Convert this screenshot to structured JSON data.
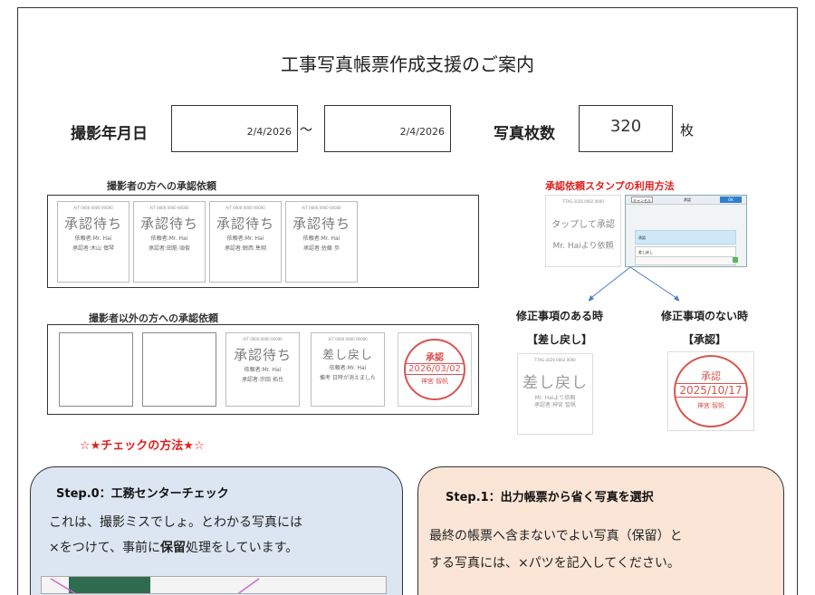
{
  "title": "工事写真帳票作成支援のご案内",
  "header": {
    "date_label": "撮影年月日",
    "date_from": "2/4/2026",
    "tilde": "～",
    "date_to": "2/4/2026",
    "count_label": "写真枚数",
    "count_value": "320",
    "count_unit": "枚"
  },
  "photographer_section": {
    "label": "撮影者の方への承認依頼",
    "stamps": [
      {
        "hdr": "A/T 0000 0000 00000",
        "big": "承認待ち",
        "line1": "依頼者:Mr. Hai",
        "line2": "承認者:木山 慎琴"
      },
      {
        "hdr": "A/T 0000 0000 00000",
        "big": "承認待ち",
        "line1": "依頼者:Mr. Hai",
        "line2": "承認者:田筋 頃俊"
      },
      {
        "hdr": "A/T 0000 0000 00000",
        "big": "承認待ち",
        "line1": "依頼者:Mr. Hai",
        "line2": "承認者:鯨西 隼翔"
      },
      {
        "hdr": "A/T 0000 0000 00000",
        "big": "承認待ち",
        "line1": "依頼者:Mr. Hai",
        "line2": "承認者:佐藤 歩"
      }
    ]
  },
  "others_section": {
    "label": "撮影者以外の方への承認依頼",
    "stamp_wait": {
      "hdr": "A/T 0000 0000 00000",
      "big": "承認待ち",
      "line1": "依頼者:Mr. Hai",
      "line2": "承認者:宗田 拓也"
    },
    "stamp_back": {
      "hdr": "A/T 0000 0000 00000",
      "big": "差し戻し",
      "line1": "依頼者:Mr. Hai",
      "line2": "備考 日時が消えました"
    },
    "seal": {
      "top": "承認",
      "date": "2026/03/02",
      "name": "神宮 智帆"
    }
  },
  "usage": {
    "label": "承認依頼スタンプの利用方法",
    "tap_stamp": {
      "hdr": "T-TAG-2026 0002 0000",
      "line1": "タップして承認",
      "line2": "Mr. Haiより依頼"
    },
    "mini_ui": {
      "cancel": "キャンセル",
      "approve_title": "承認",
      "ok": "OK",
      "row1": "承認",
      "row2": "差し戻し"
    },
    "with_fix_title": "修正事項のある時",
    "with_fix_sub": "【差し戻し】",
    "no_fix_title": "修正事項のない時",
    "no_fix_sub": "【承認】",
    "back_stamp": {
      "hdr": "T-TAG-2026 0002 0000",
      "big": "差し戻し",
      "line1": "Mr. Haiより依頼",
      "line2": "承認者:神宮 智帆"
    },
    "seal": {
      "top": "承認",
      "date": "2025/10/17",
      "name": "神宮 智帆"
    }
  },
  "check_title": "☆★チェックの方法★☆",
  "step0": {
    "title": "Step.0：工務センターチェック",
    "text1": "これは、撮影ミスでしょ。とわかる写真には",
    "text2a": "×をつけて、事前に",
    "text2b": "保留",
    "text2c": "処理をしています。"
  },
  "step1": {
    "title": "Step.1：出力帳票から省く写真を選択",
    "text1": "最終の帳票へ含まないでよい写真（保留）と",
    "text2": "する写真には、×パツを記入してください。"
  },
  "colors": {
    "accent_red": "#e0201c",
    "step0_bg": "#dce6f2",
    "step1_bg": "#fbe5d6",
    "seal": "#d9534f"
  }
}
